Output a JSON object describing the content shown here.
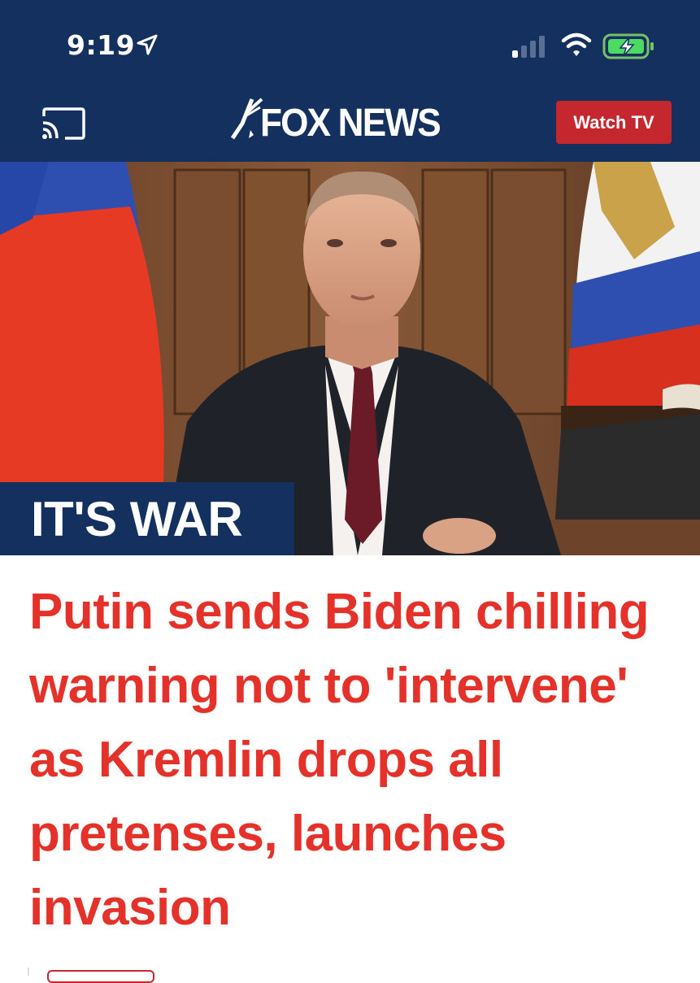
{
  "status_bar": {
    "time": "9:19",
    "icons": [
      "location-arrow-icon",
      "signal-icon",
      "wifi-icon",
      "battery-charging-icon"
    ]
  },
  "header": {
    "logo_text": "FOX NEWS",
    "cast_icon": "cast-icon",
    "watch_button_label": "Watch TV"
  },
  "hero": {
    "label": "IT'S WAR"
  },
  "headline": "Putin sends Biden chilling warning not to 'intervene' as Kremlin drops all pretenses, launches invasion",
  "colors": {
    "navy": "#14305f",
    "red": "#c4282e",
    "headline_red": "#e4312a"
  }
}
